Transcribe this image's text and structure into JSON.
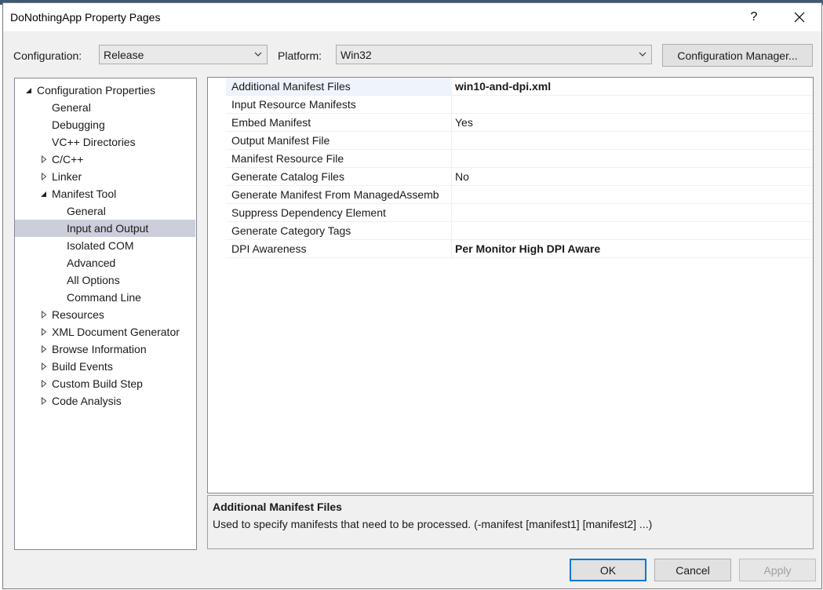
{
  "window": {
    "title": "DoNothingApp Property Pages",
    "help_label": "?"
  },
  "toolbar": {
    "configuration_label": "Configuration:",
    "configuration_value": "Release",
    "platform_label": "Platform:",
    "platform_value": "Win32",
    "config_manager_label": "Configuration Manager..."
  },
  "tree": {
    "items": [
      {
        "label": "Configuration Properties",
        "level": 0,
        "expander": "expanded"
      },
      {
        "label": "General",
        "level": 1,
        "expander": "none"
      },
      {
        "label": "Debugging",
        "level": 1,
        "expander": "none"
      },
      {
        "label": "VC++ Directories",
        "level": 1,
        "expander": "none"
      },
      {
        "label": "C/C++",
        "level": 1,
        "expander": "collapsed"
      },
      {
        "label": "Linker",
        "level": 1,
        "expander": "collapsed"
      },
      {
        "label": "Manifest Tool",
        "level": 1,
        "expander": "expanded"
      },
      {
        "label": "General",
        "level": 2,
        "expander": "none"
      },
      {
        "label": "Input and Output",
        "level": 2,
        "expander": "none",
        "selected": true
      },
      {
        "label": "Isolated COM",
        "level": 2,
        "expander": "none"
      },
      {
        "label": "Advanced",
        "level": 2,
        "expander": "none"
      },
      {
        "label": "All Options",
        "level": 2,
        "expander": "none"
      },
      {
        "label": "Command Line",
        "level": 2,
        "expander": "none"
      },
      {
        "label": "Resources",
        "level": 1,
        "expander": "collapsed"
      },
      {
        "label": "XML Document Generator",
        "level": 1,
        "expander": "collapsed"
      },
      {
        "label": "Browse Information",
        "level": 1,
        "expander": "collapsed"
      },
      {
        "label": "Build Events",
        "level": 1,
        "expander": "collapsed"
      },
      {
        "label": "Custom Build Step",
        "level": 1,
        "expander": "collapsed"
      },
      {
        "label": "Code Analysis",
        "level": 1,
        "expander": "collapsed"
      }
    ]
  },
  "properties": {
    "rows": [
      {
        "name": "Additional Manifest Files",
        "value": "win10-and-dpi.xml",
        "bold": true,
        "selected": true
      },
      {
        "name": "Input Resource Manifests",
        "value": ""
      },
      {
        "name": "Embed Manifest",
        "value": "Yes"
      },
      {
        "name": "Output Manifest File",
        "value": ""
      },
      {
        "name": "Manifest Resource File",
        "value": ""
      },
      {
        "name": "Generate Catalog Files",
        "value": "No"
      },
      {
        "name": "Generate Manifest From ManagedAssemb",
        "value": ""
      },
      {
        "name": "Suppress Dependency Element",
        "value": ""
      },
      {
        "name": "Generate Category Tags",
        "value": ""
      },
      {
        "name": "DPI Awareness",
        "value": "Per Monitor High DPI Aware",
        "bold": true
      }
    ]
  },
  "description": {
    "title": "Additional Manifest Files",
    "body": "Used to specify manifests that need to be processed. (-manifest [manifest1] [manifest2] ...)"
  },
  "footer": {
    "ok_label": "OK",
    "cancel_label": "Cancel",
    "apply_label": "Apply"
  },
  "colors": {
    "selection_tree": "#cccedb",
    "selection_grid": "#eef4fb",
    "primary_border": "#0078d7"
  }
}
